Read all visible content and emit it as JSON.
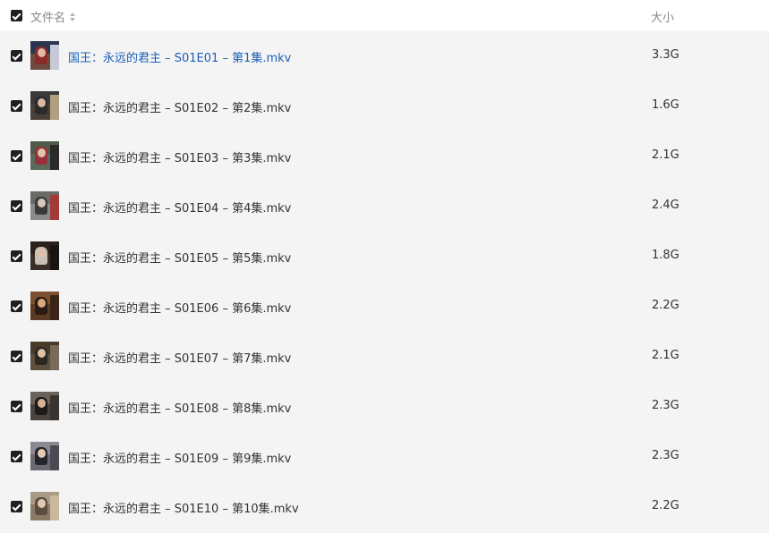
{
  "header": {
    "name_label": "文件名",
    "size_label": "大小",
    "select_all_checked": true
  },
  "files": [
    {
      "name": "国王：永远的君主 – S01E01 – 第1集.mkv",
      "size": "3.3G",
      "checked": true,
      "active": true
    },
    {
      "name": "国王：永远的君主 – S01E02 – 第2集.mkv",
      "size": "1.6G",
      "checked": true
    },
    {
      "name": "国王：永远的君主 – S01E03 – 第3集.mkv",
      "size": "2.1G",
      "checked": true
    },
    {
      "name": "国王：永远的君主 – S01E04 – 第4集.mkv",
      "size": "2.4G",
      "checked": true
    },
    {
      "name": "国王：永远的君主 – S01E05 – 第5集.mkv",
      "size": "1.8G",
      "checked": true
    },
    {
      "name": "国王：永远的君主 – S01E06 – 第6集.mkv",
      "size": "2.2G",
      "checked": true
    },
    {
      "name": "国王：永远的君主 – S01E07 – 第7集.mkv",
      "size": "2.1G",
      "checked": true
    },
    {
      "name": "国王：永远的君主 – S01E08 – 第8集.mkv",
      "size": "2.3G",
      "checked": true
    },
    {
      "name": "国王：永远的君主 – S01E09 – 第9集.mkv",
      "size": "2.3G",
      "checked": true
    },
    {
      "name": "国王：永远的君主 – S01E10 – 第10集.mkv",
      "size": "2.2G",
      "checked": true
    }
  ],
  "colors": {
    "active_text": "#1a5fb4",
    "row_bg": "#f4f4f4",
    "checkbox": "#1f1f1f"
  }
}
